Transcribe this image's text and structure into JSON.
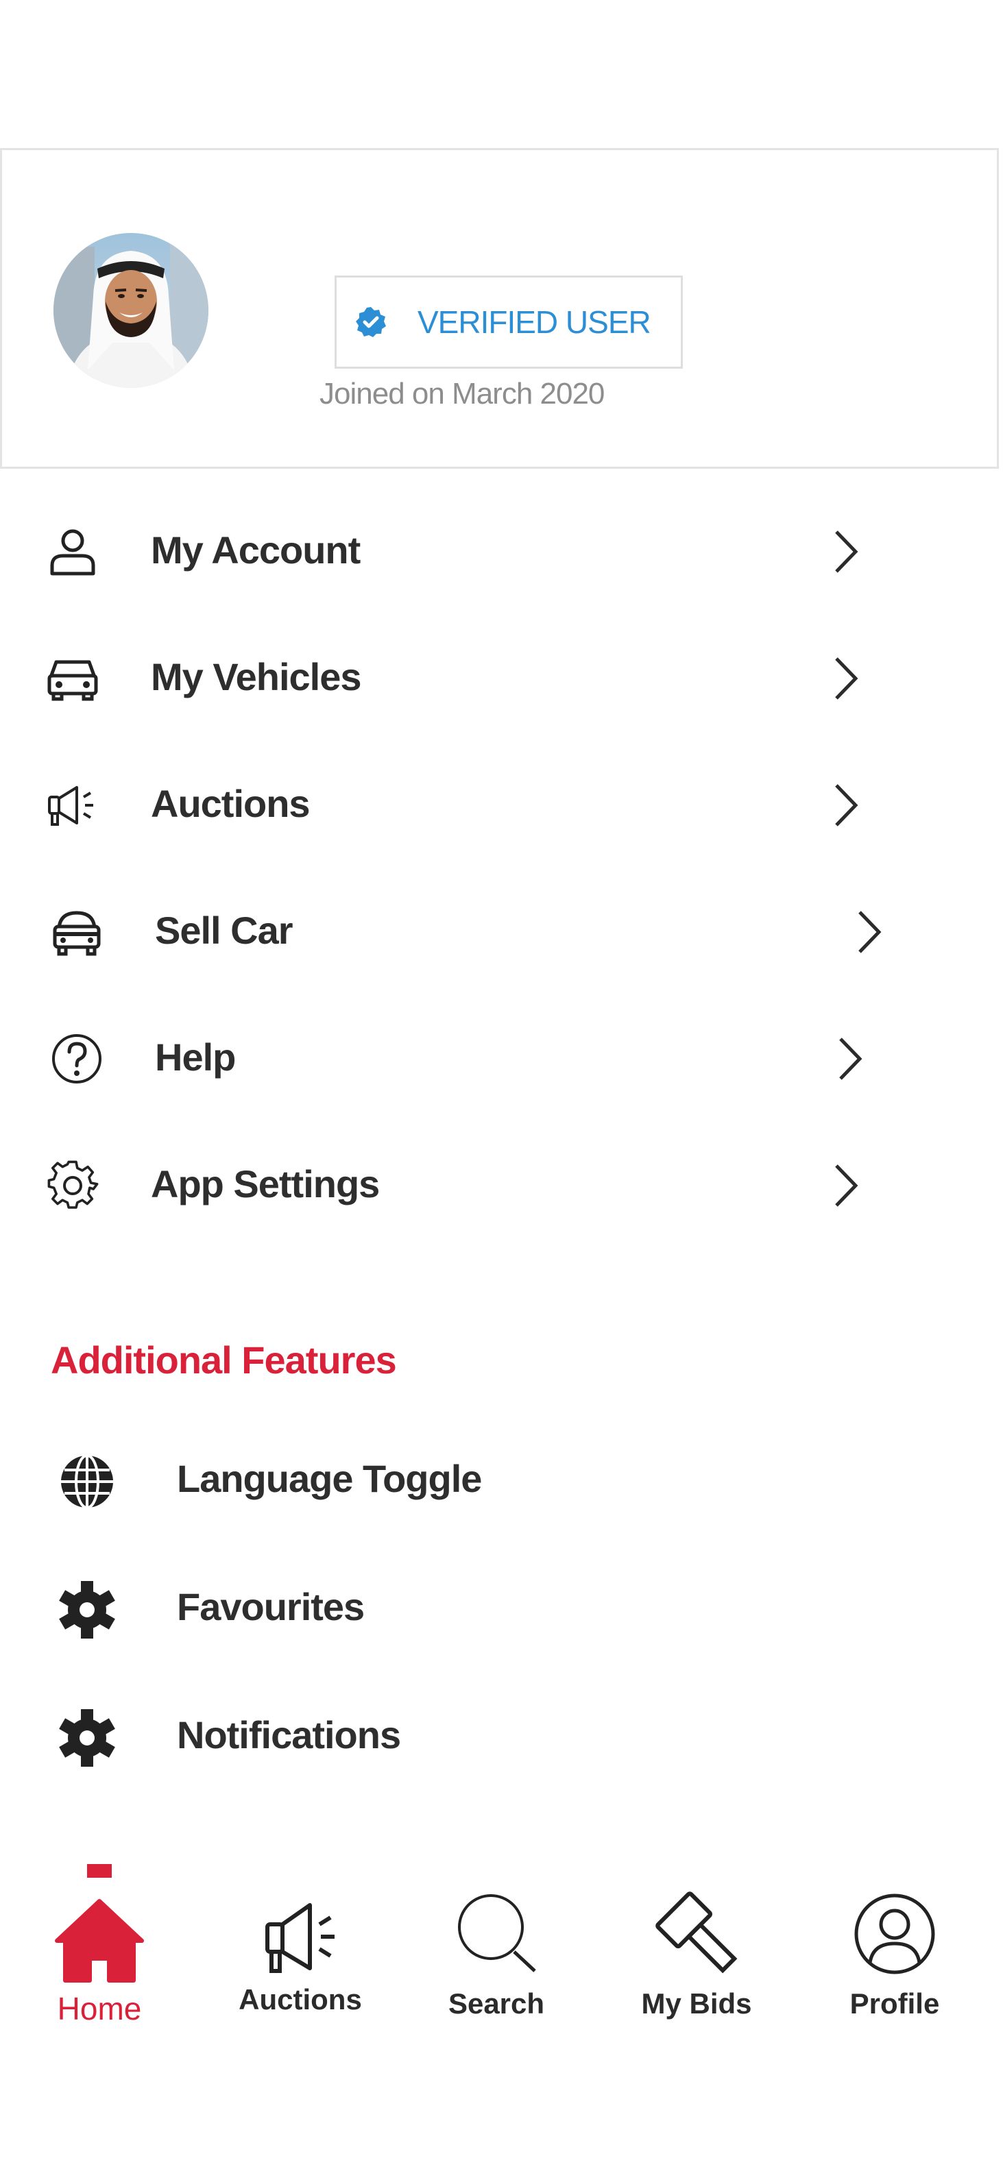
{
  "profile": {
    "verified_label": "VERIFIED USER",
    "joined_text": "Joined on March 2020"
  },
  "menu": [
    {
      "label": "My Account",
      "icon": "user-icon"
    },
    {
      "label": "My Vehicles",
      "icon": "car-icon"
    },
    {
      "label": "Auctions",
      "icon": "megaphone-icon"
    },
    {
      "label": "Sell Car",
      "icon": "car-front-icon"
    },
    {
      "label": "Help",
      "icon": "help-circle-icon"
    },
    {
      "label": "App Settings",
      "icon": "gear-outline-icon"
    }
  ],
  "additional_features": {
    "title": "Additional Features",
    "items": [
      {
        "label": "Language Toggle",
        "icon": "globe-icon"
      },
      {
        "label": "Favourites",
        "icon": "gear-solid-icon"
      },
      {
        "label": "Notifications",
        "icon": "gear-solid-icon"
      }
    ]
  },
  "bottom_nav": [
    {
      "label": "Home",
      "icon": "home-icon",
      "active": true
    },
    {
      "label": "Auctions",
      "icon": "megaphone-icon"
    },
    {
      "label": "Search",
      "icon": "search-icon"
    },
    {
      "label": "My Bids",
      "icon": "gavel-icon"
    },
    {
      "label": "Profile",
      "icon": "profile-icon"
    }
  ],
  "colors": {
    "accent": "#d9213a",
    "verified": "#2c8fd6",
    "text": "#2e2e2e",
    "muted": "#8d8d8d"
  }
}
